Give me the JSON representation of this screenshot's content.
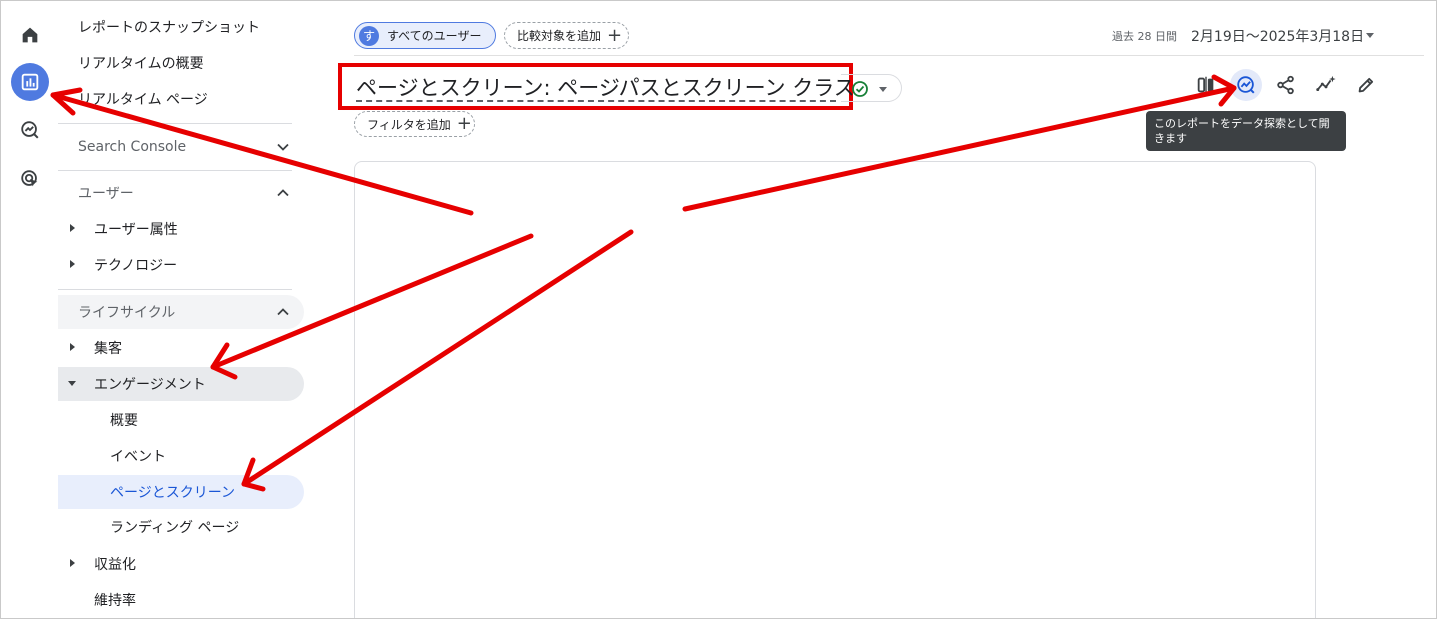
{
  "nav_rail": {
    "items": [
      {
        "icon": "home-icon"
      },
      {
        "icon": "reports-bar-chart-icon",
        "active": true
      },
      {
        "icon": "explore-icon"
      },
      {
        "icon": "advertising-icon"
      }
    ]
  },
  "sidebar": {
    "items": [
      {
        "label": "レポートのスナップショット"
      },
      {
        "label": "リアルタイムの概要"
      },
      {
        "label": "リアルタイム ページ"
      }
    ],
    "sections": {
      "search_console": "Search Console",
      "user": "ユーザー",
      "user_attributes": "ユーザー属性",
      "technology": "テクノロジー",
      "lifecycle": "ライフサイクル",
      "acquisition": "集客",
      "engagement": "エンゲージメント",
      "overview": "概要",
      "events": "イベント",
      "pages_screens": "ページとスクリーン",
      "landing_page": "ランディング ページ",
      "monetization": "収益化",
      "retention": "維持率"
    }
  },
  "header": {
    "user_chip_avatar": "す",
    "user_chip_label": "すべてのユーザー",
    "compare_label": "比較対象を追加",
    "filter_label": "フィルタを追加",
    "date_prefix": "過去 28 日間",
    "date_range": "2月19日～2025年3月18日"
  },
  "report": {
    "title": "ページとスクリーン: ページパスとスクリーン クラス"
  },
  "toolbar": {
    "tooltip": "このレポートをデータ探索として開きます"
  },
  "colors": {
    "accent": "#4f7ae0",
    "annotation": "#e60000",
    "selected_text": "#1a56d6"
  }
}
